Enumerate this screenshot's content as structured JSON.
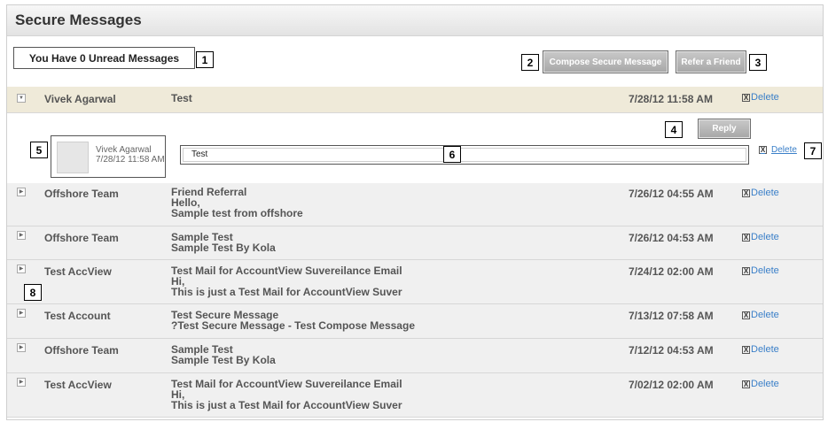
{
  "page_title": "Secure Messages",
  "unread_text": "You Have 0 Unread Messages",
  "buttons": {
    "compose": "Compose Secure Message",
    "refer": "Refer a Friend",
    "reply": "Reply"
  },
  "delete_label": "Delete",
  "delete_x": "X",
  "expand_glyph_closed": "▶",
  "expand_glyph_open": "▼",
  "open_message": {
    "sender": "Vivek Agarwal",
    "subject": "Test",
    "date": "7/28/12 11:58 AM",
    "avatar_name": "Vivek Agarwal",
    "avatar_date": "7/28/12 11:58 AM",
    "body": "Test"
  },
  "messages": [
    {
      "sender": "Offshore Team",
      "subject": "Friend Referral",
      "preview1": "Hello,",
      "preview2": "Sample test from offshore",
      "date": "7/26/12 04:55 AM"
    },
    {
      "sender": "Offshore Team",
      "subject": "Sample Test",
      "preview1": "Sample Test By Kola",
      "date": "7/26/12 04:53 AM"
    },
    {
      "sender": "Test AccView",
      "subject": "Test Mail for AccountView Suvereilance Email",
      "preview1": "Hi,",
      "preview2": "This is just a Test Mail for AccountView Suver",
      "date": "7/24/12 02:00 AM"
    },
    {
      "sender": "Test Account",
      "subject": "Test Secure Message",
      "preview1": "?Test Secure Message - Test Compose Message",
      "date": "7/13/12 07:58 AM"
    },
    {
      "sender": "Offshore Team",
      "subject": "Sample Test",
      "preview1": "Sample Test By Kola",
      "date": "7/12/12 04:53 AM"
    },
    {
      "sender": "Test AccView",
      "subject": "Test Mail for AccountView Suvereilance Email",
      "preview1": "Hi,",
      "preview2": "This is just a Test Mail for AccountView Suver",
      "date": "7/02/12 02:00 AM"
    }
  ],
  "callouts": [
    "1",
    "2",
    "3",
    "4",
    "5",
    "6",
    "7",
    "8"
  ]
}
